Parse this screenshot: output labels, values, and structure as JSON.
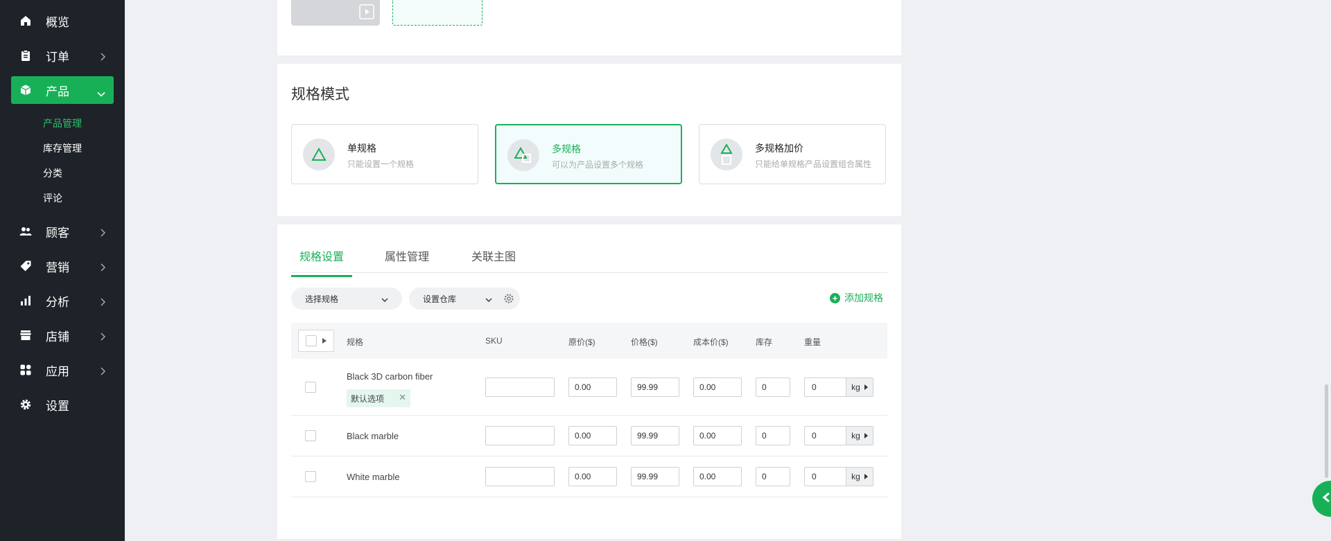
{
  "sidebar": {
    "items": [
      {
        "label": "概览",
        "icon": "home-icon"
      },
      {
        "label": "订单",
        "icon": "clipboard-icon"
      },
      {
        "label": "产品",
        "icon": "box-icon"
      },
      {
        "label": "顾客",
        "icon": "users-icon"
      },
      {
        "label": "营销",
        "icon": "tag-icon"
      },
      {
        "label": "分析",
        "icon": "bar-chart-icon"
      },
      {
        "label": "店铺",
        "icon": "store-icon"
      },
      {
        "label": "应用",
        "icon": "apps-icon"
      },
      {
        "label": "设置",
        "icon": "gear-icon"
      }
    ],
    "sub_items": [
      {
        "label": "产品管理"
      },
      {
        "label": "库存管理"
      },
      {
        "label": "分类"
      },
      {
        "label": "评论"
      }
    ]
  },
  "spec_mode": {
    "title": "规格模式",
    "options": [
      {
        "title": "单规格",
        "desc": "只能设置一个规格"
      },
      {
        "title": "多规格",
        "desc": "可以为产品设置多个规格"
      },
      {
        "title": "多规格加价",
        "desc": "只能给单规格产品设置组合属性"
      }
    ]
  },
  "spec": {
    "tabs": [
      {
        "label": "规格设置"
      },
      {
        "label": "属性管理"
      },
      {
        "label": "关联主图"
      }
    ],
    "select_spec": "选择规格",
    "set_warehouse": "设置仓库",
    "add_spec": "添加规格",
    "headers": {
      "spec": "规格",
      "sku": "SKU",
      "original_price": "原价($)",
      "price": "价格($)",
      "cost": "成本价($)",
      "stock": "库存",
      "weight": "重量"
    },
    "rows": [
      {
        "name": "Black 3D carbon fiber",
        "tag": "默认选项",
        "sku": "",
        "original_price": "0.00",
        "price": "99.99",
        "cost": "0.00",
        "stock": "0",
        "weight": "0",
        "unit": "kg"
      },
      {
        "name": "Black marble",
        "sku": "",
        "original_price": "0.00",
        "price": "99.99",
        "cost": "0.00",
        "stock": "0",
        "weight": "0",
        "unit": "kg"
      },
      {
        "name": "White marble",
        "sku": "",
        "original_price": "0.00",
        "price": "99.99",
        "cost": "0.00",
        "stock": "0",
        "weight": "0",
        "unit": "kg"
      }
    ]
  },
  "colors": {
    "accent": "#18b057",
    "sidebar_bg": "#1e2329",
    "page_bg": "#eef0f3"
  }
}
